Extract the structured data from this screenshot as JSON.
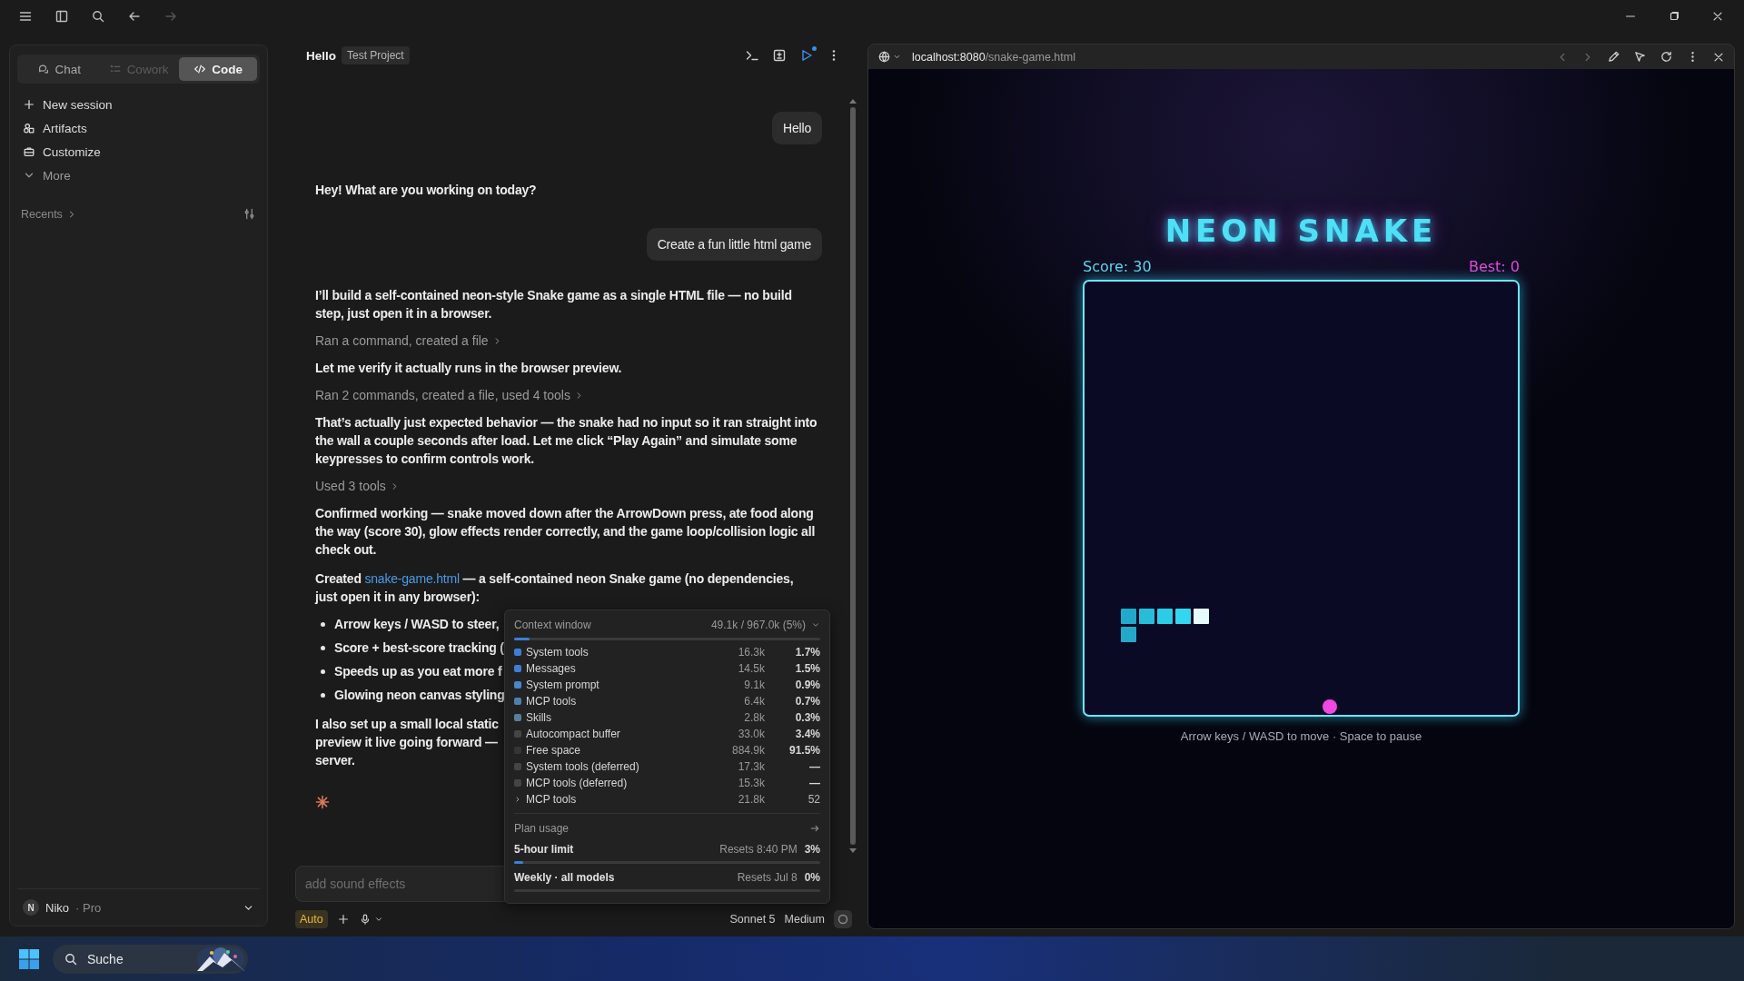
{
  "sidebar": {
    "mode_tabs": [
      {
        "label": "Chat",
        "selected": false,
        "disabled": false
      },
      {
        "label": "Cowork",
        "selected": false,
        "disabled": true
      },
      {
        "label": "Code",
        "selected": true,
        "disabled": false
      }
    ],
    "nav": [
      {
        "label": "New session"
      },
      {
        "label": "Artifacts"
      },
      {
        "label": "Customize"
      },
      {
        "label": "More"
      }
    ],
    "recents": "Recents",
    "user": {
      "initial": "N",
      "name": "Niko",
      "plan": "· Pro"
    }
  },
  "chat": {
    "title": "Hello",
    "project": "Test Project",
    "messages": [
      {
        "kind": "user",
        "text": "Hello"
      },
      {
        "kind": "assistant",
        "text": "Hey! What are you working on today?"
      },
      {
        "kind": "user",
        "text": "Create a fun little html game"
      },
      {
        "kind": "assistant",
        "text": "I’ll build a self-contained neon-style Snake game as a single HTML file — no build step, just open it in a browser."
      },
      {
        "kind": "tool",
        "text": "Ran a command, created a file"
      },
      {
        "kind": "assistant",
        "text": "Let me verify it actually runs in the browser preview."
      },
      {
        "kind": "tool",
        "text": "Ran 2 commands, created a file, used 4 tools"
      },
      {
        "kind": "assistant",
        "text": "That’s actually just expected behavior — the snake had no input so it ran straight into the wall a couple seconds after load. Let me click “Play Again” and simulate some keypresses to confirm controls work."
      },
      {
        "kind": "tool",
        "text": "Used 3 tools"
      },
      {
        "kind": "assistant",
        "text": "Confirmed working — snake moved down after the ArrowDown press, ate food along the way (score 30), glow effects render correctly, and the game loop/collision logic all check out."
      },
      {
        "kind": "link_text",
        "before": "Created",
        "link": "snake-game.html",
        "after": "— a self-contained neon Snake game (no dependencies,",
        "after_line": "just open it in any browser):"
      },
      {
        "kind": "bullets",
        "items": [
          "Arrow keys / WASD to steer,",
          "Score + best-score tracking (",
          "Speeds up as you eat more f",
          "Glowing neon canvas styling"
        ]
      },
      {
        "kind": "lines",
        "lines": [
          "I also set up a small local static",
          "preview it live going forward —",
          "server."
        ]
      },
      {
        "kind": "working"
      }
    ],
    "composer": {
      "placeholder": "add sound effects",
      "mode": "Auto",
      "model": "Sonnet 5",
      "effort": "Medium"
    },
    "context": {
      "title": "Context window",
      "total": "49.1k / 967.0k (5%)",
      "level": 0.05,
      "rows": [
        {
          "kind": "item",
          "label": "System tools",
          "tokens": "16.3k",
          "share": "1.7%",
          "color": "#3d7fd6"
        },
        {
          "kind": "item",
          "label": "Messages",
          "tokens": "14.5k",
          "share": "1.5%",
          "color": "#3d7fd6"
        },
        {
          "kind": "item",
          "label": "System prompt",
          "tokens": "9.1k",
          "share": "0.9%",
          "color": "#4a86c8"
        },
        {
          "kind": "item",
          "label": "MCP tools",
          "tokens": "6.4k",
          "share": "0.7%",
          "color": "#4f7fae"
        },
        {
          "kind": "item",
          "label": "Skills",
          "tokens": "2.8k",
          "share": "0.3%",
          "color": "#5c7c9c"
        },
        {
          "kind": "item",
          "label": "Autocompact buffer",
          "tokens": "33.0k",
          "share": "3.4%",
          "color": "#454545"
        },
        {
          "kind": "item",
          "label": "Free space",
          "tokens": "884.9k",
          "share": "91.5%",
          "color": "#353535"
        },
        {
          "kind": "item",
          "label": "System tools (deferred)",
          "tokens": "17.3k",
          "share": "—",
          "color": "#454545"
        },
        {
          "kind": "item",
          "label": "MCP tools (deferred)",
          "tokens": "15.3k",
          "share": "—",
          "color": "#454545"
        },
        {
          "kind": "group",
          "label": "MCP tools",
          "tokens": "21.8k",
          "share": "52",
          "expanded": false
        }
      ],
      "plan_title": "Plan usage",
      "limits": [
        {
          "label": "5-hour limit",
          "resets": "Resets 8:40 PM",
          "percent": "3%",
          "level": 0.03
        },
        {
          "label": "Weekly · all models",
          "resets": "Resets Jul 8",
          "percent": "0%",
          "level": 0
        }
      ]
    }
  },
  "browser": {
    "host": "localhost:8080",
    "path": "/snake-game.html",
    "game": {
      "title": "NEON SNAKE",
      "score": "Score: 30",
      "best": "Best: 0",
      "hint": "Arrow keys / WASD to move · Space to pause"
    }
  },
  "taskbar": {
    "search": {
      "placeholder": "Suche"
    }
  }
}
